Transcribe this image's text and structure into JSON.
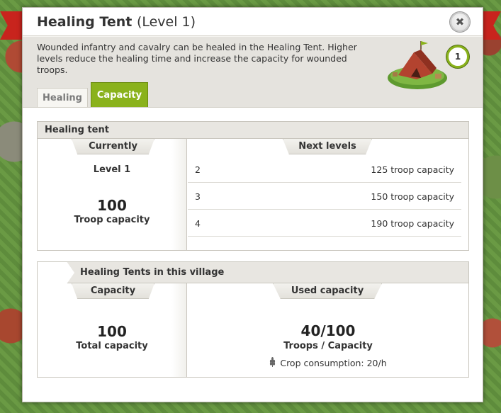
{
  "window": {
    "title": "Healing Tent",
    "title_level": "(Level 1)",
    "close_symbol": "✖",
    "description": "Wounded infantry and cavalry can be healed in the Healing Tent. Higher levels reduce the healing time and increase the capacity for wounded troops.",
    "building_level_badge": "1"
  },
  "tabs": [
    {
      "label": "Healing",
      "active": false
    },
    {
      "label": "Capacity",
      "active": true
    }
  ],
  "healing_tent_panel": {
    "heading": "Healing tent",
    "currently_label": "Currently",
    "current_level": "Level 1",
    "current_capacity_value": "100",
    "current_capacity_label": "Troop capacity",
    "next_levels_label": "Next levels",
    "next_levels": [
      {
        "level": "2",
        "capacity": "125 troop capacity"
      },
      {
        "level": "3",
        "capacity": "150 troop capacity"
      },
      {
        "level": "4",
        "capacity": "190 troop capacity"
      }
    ]
  },
  "village_panel": {
    "heading": "Healing Tents in this village",
    "capacity_label": "Capacity",
    "total_capacity_value": "100",
    "total_capacity_label": "Total capacity",
    "used_capacity_label": "Used capacity",
    "used_value": "40",
    "used_separator": "/",
    "max_value": "100",
    "troops_capacity_label": "Troops / Capacity",
    "crop_consumption": "Crop consumption: 20/h"
  },
  "colors": {
    "accent_green": "#8ab21c",
    "ribbon_red": "#c8241d"
  }
}
